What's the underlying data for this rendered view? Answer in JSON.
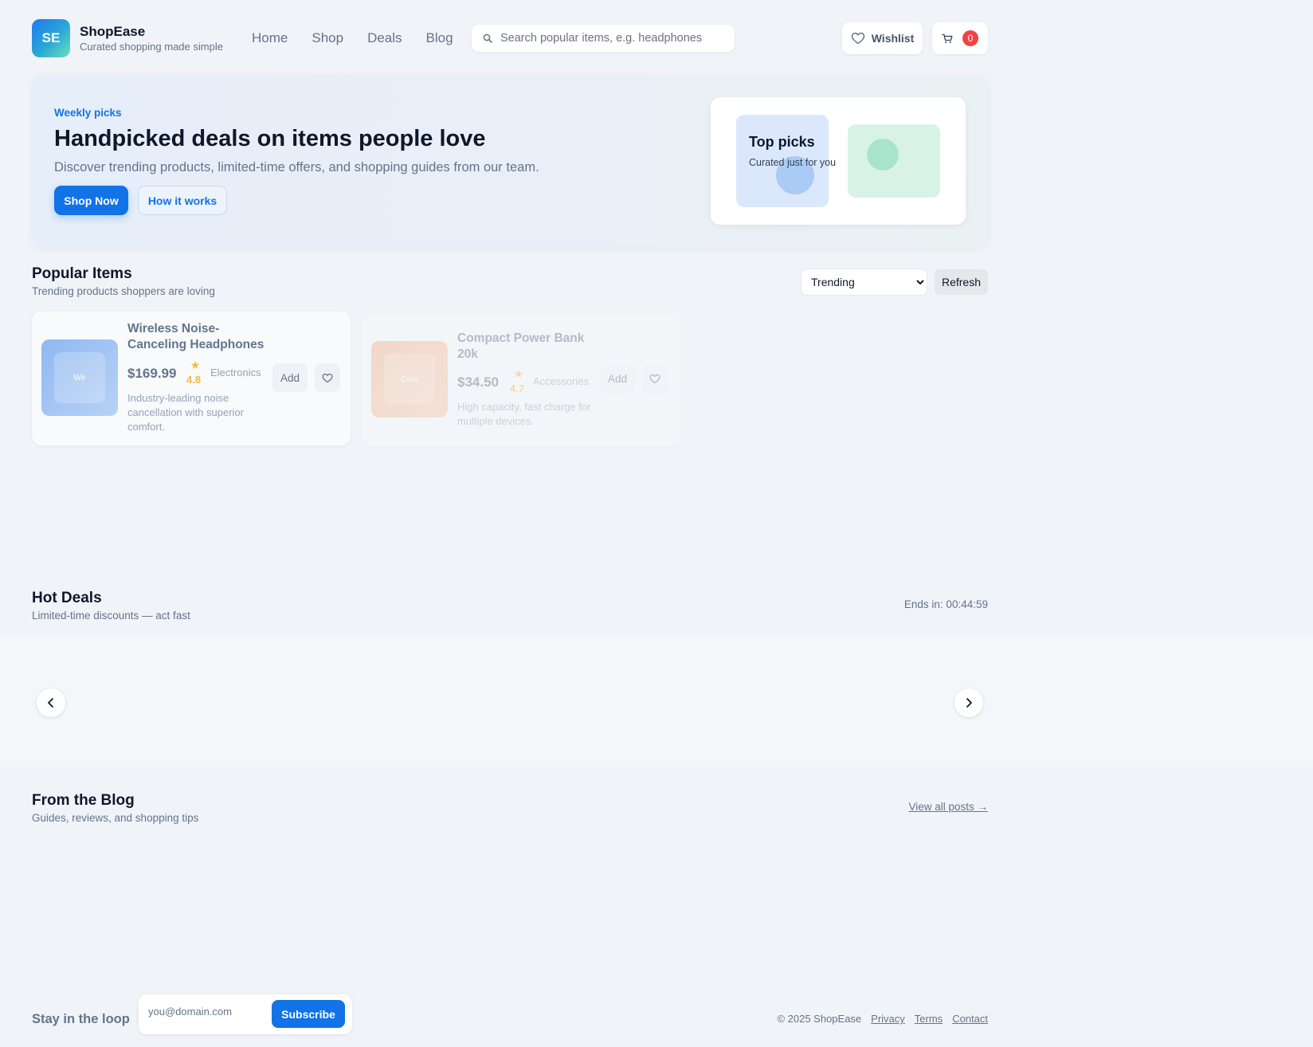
{
  "header": {
    "logo_initials": "SE",
    "brand_name": "ShopEase",
    "tagline": "Curated shopping made simple",
    "nav": [
      "Home",
      "Shop",
      "Deals",
      "Blog"
    ],
    "search_placeholder": "Search popular items, e.g. headphones",
    "wishlist_label": "Wishlist",
    "cart_count": "0"
  },
  "hero": {
    "kicker": "Weekly picks",
    "title": "Handpicked deals on items people love",
    "subtitle": "Discover trending products, limited-time offers, and shopping guides from our team.",
    "primary_cta": "Shop Now",
    "secondary_cta": "How it works",
    "card_title": "Top picks",
    "card_subtitle": "Curated just for you"
  },
  "popular": {
    "title": "Popular Items",
    "subtitle": "Trending products shoppers are loving",
    "sort_selected": "Trending",
    "refresh_label": "Refresh",
    "products": [
      {
        "name": "Wireless Noise-Canceling Headphones",
        "thumb_label": "Wir",
        "price": "$169.99",
        "rating": "4.8",
        "category": "Electronics",
        "description": "Industry-leading noise cancellation with superior comfort.",
        "add_label": "Add"
      },
      {
        "name": "Compact Power Bank 20k",
        "thumb_label": "Com",
        "price": "$34.50",
        "rating": "4.7",
        "category": "Accessories",
        "description": "High capacity, fast charge for multiple devices.",
        "add_label": "Add"
      }
    ]
  },
  "deals": {
    "title": "Hot Deals",
    "subtitle": "Limited-time discounts — act fast",
    "ends_in": "Ends in: 00:44:59"
  },
  "blog": {
    "title": "From the Blog",
    "subtitle": "Guides, reviews, and shopping tips",
    "view_all": "View all posts →"
  },
  "footer": {
    "newsletter_label": "Stay in the loop",
    "email_placeholder": "you@domain.com",
    "subscribe_label": "Subscribe",
    "copyright": "© 2025 ShopEase",
    "links": [
      "Privacy",
      "Terms",
      "Contact"
    ]
  },
  "colors": {
    "accent": "#1173e6",
    "badge": "#ef4444",
    "star": "#f5b942"
  }
}
